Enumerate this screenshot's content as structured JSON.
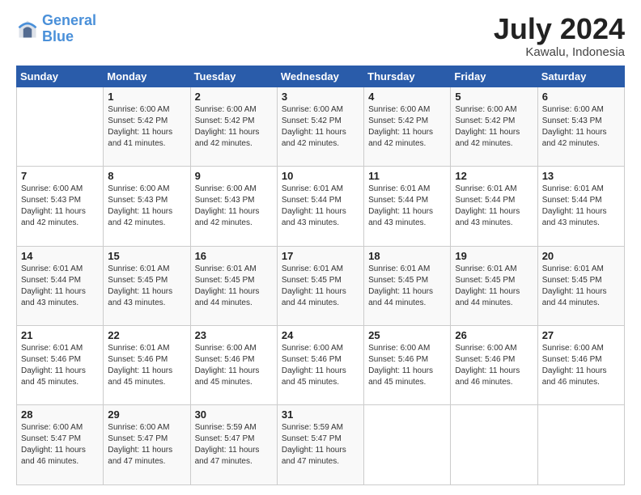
{
  "logo": {
    "line1": "General",
    "line2": "Blue"
  },
  "title": "July 2024",
  "location": "Kawalu, Indonesia",
  "days_header": [
    "Sunday",
    "Monday",
    "Tuesday",
    "Wednesday",
    "Thursday",
    "Friday",
    "Saturday"
  ],
  "weeks": [
    [
      {
        "num": "",
        "info": ""
      },
      {
        "num": "1",
        "info": "Sunrise: 6:00 AM\nSunset: 5:42 PM\nDaylight: 11 hours\nand 41 minutes."
      },
      {
        "num": "2",
        "info": "Sunrise: 6:00 AM\nSunset: 5:42 PM\nDaylight: 11 hours\nand 42 minutes."
      },
      {
        "num": "3",
        "info": "Sunrise: 6:00 AM\nSunset: 5:42 PM\nDaylight: 11 hours\nand 42 minutes."
      },
      {
        "num": "4",
        "info": "Sunrise: 6:00 AM\nSunset: 5:42 PM\nDaylight: 11 hours\nand 42 minutes."
      },
      {
        "num": "5",
        "info": "Sunrise: 6:00 AM\nSunset: 5:42 PM\nDaylight: 11 hours\nand 42 minutes."
      },
      {
        "num": "6",
        "info": "Sunrise: 6:00 AM\nSunset: 5:43 PM\nDaylight: 11 hours\nand 42 minutes."
      }
    ],
    [
      {
        "num": "7",
        "info": "Sunrise: 6:00 AM\nSunset: 5:43 PM\nDaylight: 11 hours\nand 42 minutes."
      },
      {
        "num": "8",
        "info": "Sunrise: 6:00 AM\nSunset: 5:43 PM\nDaylight: 11 hours\nand 42 minutes."
      },
      {
        "num": "9",
        "info": "Sunrise: 6:00 AM\nSunset: 5:43 PM\nDaylight: 11 hours\nand 42 minutes."
      },
      {
        "num": "10",
        "info": "Sunrise: 6:01 AM\nSunset: 5:44 PM\nDaylight: 11 hours\nand 43 minutes."
      },
      {
        "num": "11",
        "info": "Sunrise: 6:01 AM\nSunset: 5:44 PM\nDaylight: 11 hours\nand 43 minutes."
      },
      {
        "num": "12",
        "info": "Sunrise: 6:01 AM\nSunset: 5:44 PM\nDaylight: 11 hours\nand 43 minutes."
      },
      {
        "num": "13",
        "info": "Sunrise: 6:01 AM\nSunset: 5:44 PM\nDaylight: 11 hours\nand 43 minutes."
      }
    ],
    [
      {
        "num": "14",
        "info": "Sunrise: 6:01 AM\nSunset: 5:44 PM\nDaylight: 11 hours\nand 43 minutes."
      },
      {
        "num": "15",
        "info": "Sunrise: 6:01 AM\nSunset: 5:45 PM\nDaylight: 11 hours\nand 43 minutes."
      },
      {
        "num": "16",
        "info": "Sunrise: 6:01 AM\nSunset: 5:45 PM\nDaylight: 11 hours\nand 44 minutes."
      },
      {
        "num": "17",
        "info": "Sunrise: 6:01 AM\nSunset: 5:45 PM\nDaylight: 11 hours\nand 44 minutes."
      },
      {
        "num": "18",
        "info": "Sunrise: 6:01 AM\nSunset: 5:45 PM\nDaylight: 11 hours\nand 44 minutes."
      },
      {
        "num": "19",
        "info": "Sunrise: 6:01 AM\nSunset: 5:45 PM\nDaylight: 11 hours\nand 44 minutes."
      },
      {
        "num": "20",
        "info": "Sunrise: 6:01 AM\nSunset: 5:45 PM\nDaylight: 11 hours\nand 44 minutes."
      }
    ],
    [
      {
        "num": "21",
        "info": "Sunrise: 6:01 AM\nSunset: 5:46 PM\nDaylight: 11 hours\nand 45 minutes."
      },
      {
        "num": "22",
        "info": "Sunrise: 6:01 AM\nSunset: 5:46 PM\nDaylight: 11 hours\nand 45 minutes."
      },
      {
        "num": "23",
        "info": "Sunrise: 6:00 AM\nSunset: 5:46 PM\nDaylight: 11 hours\nand 45 minutes."
      },
      {
        "num": "24",
        "info": "Sunrise: 6:00 AM\nSunset: 5:46 PM\nDaylight: 11 hours\nand 45 minutes."
      },
      {
        "num": "25",
        "info": "Sunrise: 6:00 AM\nSunset: 5:46 PM\nDaylight: 11 hours\nand 45 minutes."
      },
      {
        "num": "26",
        "info": "Sunrise: 6:00 AM\nSunset: 5:46 PM\nDaylight: 11 hours\nand 46 minutes."
      },
      {
        "num": "27",
        "info": "Sunrise: 6:00 AM\nSunset: 5:46 PM\nDaylight: 11 hours\nand 46 minutes."
      }
    ],
    [
      {
        "num": "28",
        "info": "Sunrise: 6:00 AM\nSunset: 5:47 PM\nDaylight: 11 hours\nand 46 minutes."
      },
      {
        "num": "29",
        "info": "Sunrise: 6:00 AM\nSunset: 5:47 PM\nDaylight: 11 hours\nand 47 minutes."
      },
      {
        "num": "30",
        "info": "Sunrise: 5:59 AM\nSunset: 5:47 PM\nDaylight: 11 hours\nand 47 minutes."
      },
      {
        "num": "31",
        "info": "Sunrise: 5:59 AM\nSunset: 5:47 PM\nDaylight: 11 hours\nand 47 minutes."
      },
      {
        "num": "",
        "info": ""
      },
      {
        "num": "",
        "info": ""
      },
      {
        "num": "",
        "info": ""
      }
    ]
  ]
}
